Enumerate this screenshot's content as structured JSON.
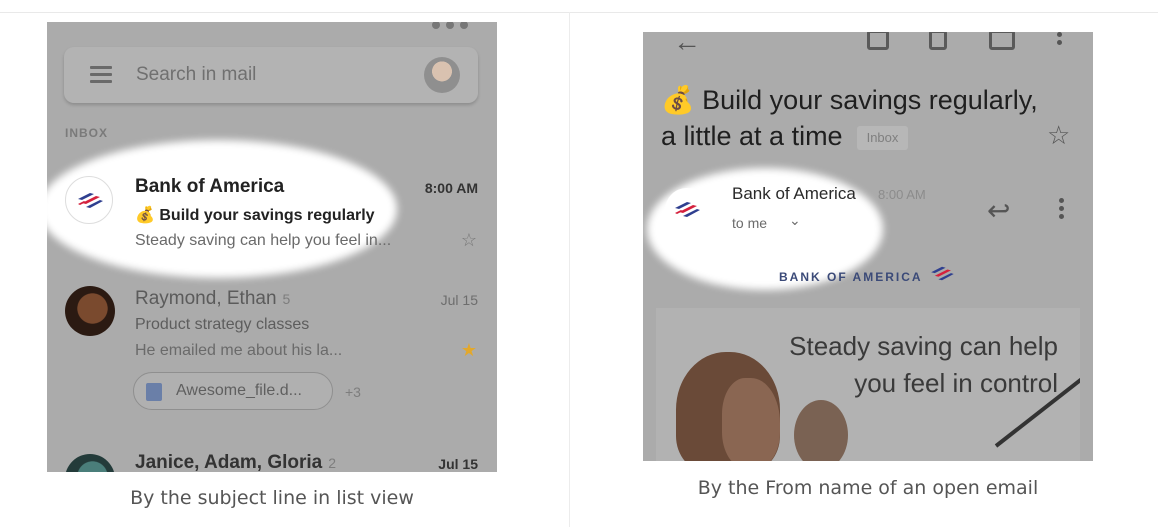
{
  "left_screenshot": {
    "search": {
      "placeholder": "Search in mail"
    },
    "section_label": "INBOX",
    "emails": [
      {
        "sender": "Bank of America",
        "time": "8:00 AM",
        "subject_emoji": "💰",
        "subject": "Build your savings regularly",
        "snippet": "Steady saving can help you feel in...",
        "starred": false,
        "star_icon": "star-outline-icon"
      },
      {
        "sender": "Raymond, Ethan",
        "count": "5",
        "time": "Jul 15",
        "subject": "Product strategy classes",
        "snippet": "He emailed me about his la...",
        "starred": true,
        "star_icon": "star-filled-icon",
        "attachment": {
          "name": "Awesome_file.d...",
          "more": "+3"
        }
      },
      {
        "sender": "Janice, Adam, Gloria",
        "count": "2",
        "time": "Jul 15"
      }
    ],
    "caption": "By the subject line in list view"
  },
  "right_screenshot": {
    "subject_emoji": "💰",
    "subject_line1": "Build your savings regularly,",
    "subject_line2": "a little at a time",
    "label_chip": "Inbox",
    "from_name": "Bank of America",
    "from_time": "8:00 AM",
    "recipient": "to me",
    "brand_text": "BANK OF AMERICA",
    "hero_line1": "Steady saving can help",
    "hero_line2": "you feel in control",
    "caption": "By the From name of an open email"
  },
  "colors": {
    "brand_red": "#d4213d",
    "brand_blue": "#2f3f8f",
    "star_gold": "#e3a82b",
    "dimmed_overlay": "#ababab"
  }
}
